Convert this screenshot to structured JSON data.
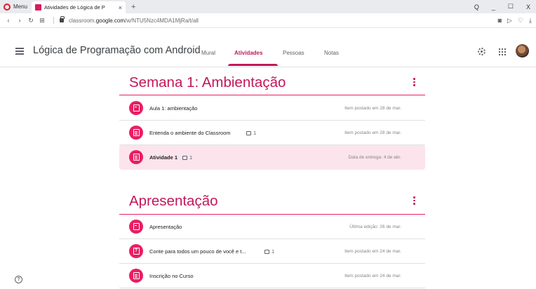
{
  "browser": {
    "menu_label": "Menu",
    "tab_title": "Atividades de Lógica de P",
    "tab_close": "×",
    "new_tab": "+",
    "url_pre": "classroom.",
    "url_host": "google.com",
    "url_post": "/w/NTU5Nzc4MDA1MjRa/t/all",
    "controls": [
      "Q",
      "_",
      "☐",
      "X"
    ]
  },
  "header": {
    "course_title": "Lógica de Programação com Android",
    "tabs": [
      {
        "label": "Mural"
      },
      {
        "label": "Atividades"
      },
      {
        "label": "Pessoas"
      },
      {
        "label": "Notas"
      }
    ]
  },
  "sections": [
    {
      "title": "Semana 1: Ambientação",
      "items": [
        {
          "icon": "material",
          "title": "Aula 1: ambientação",
          "comments": "",
          "meta": "Item postado em 28 de mar."
        },
        {
          "icon": "assignment",
          "title": "Entenda o ambiente do Classroom",
          "comments": "1",
          "meta": "Item postado em 28 de mar."
        },
        {
          "icon": "assignment",
          "title": "Atividade 1",
          "comments": "1",
          "meta": "Data de entrega: 4 de abr."
        }
      ]
    },
    {
      "title": "Apresentação",
      "items": [
        {
          "icon": "material",
          "title": "Apresentação",
          "comments": "",
          "meta": "Última edição: 26 de mar."
        },
        {
          "icon": "question",
          "title": "Conte para todos um pouco de você e t...",
          "comments": "1",
          "meta": "Item postado em 24 de mar."
        },
        {
          "icon": "assignment",
          "title": "Inscrição no Curso",
          "comments": "",
          "meta": "Item postado em 24 de mar."
        }
      ]
    }
  ],
  "colors": {
    "accent": "#c2185b",
    "icon_bg": "#e91e63",
    "highlight": "#fce4ec"
  },
  "help": "?"
}
